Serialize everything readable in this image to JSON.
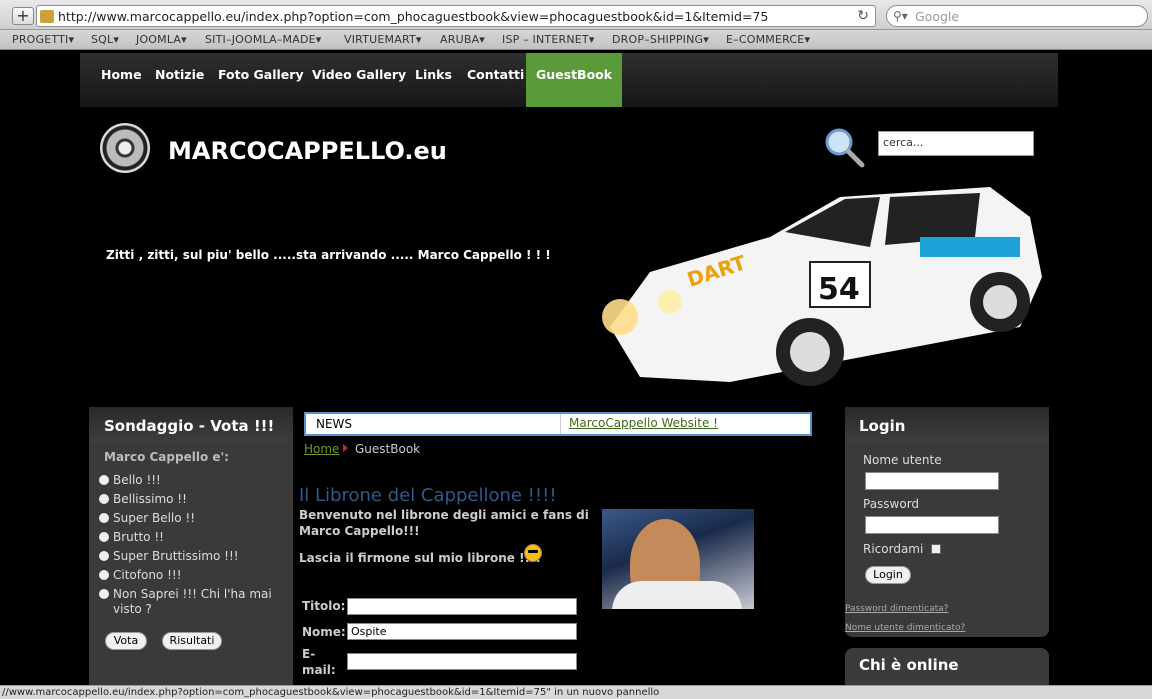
{
  "browser": {
    "url": "http://www.marcocappello.eu/index.php?option=com_phocaguestbook&view=phocaguestbook&id=1&Itemid=75",
    "search_placeholder": "Google",
    "bookmarks": [
      "PROGETTI▾",
      "SQL▾",
      "JOOMLA▾",
      "SITI–JOOMLA–MADE▾",
      "VIRTUEMART▾",
      "ARUBA▾",
      "ISP – INTERNET▾",
      "DROP–SHIPPING▾",
      "E–COMMERCE▾"
    ],
    "status_text": "//www.marcocappello.eu/index.php?option=com_phocaguestbook&view=phocaguestbook&id=1&Itemid=75\" in un nuovo pannello"
  },
  "nav": {
    "items": [
      "Home",
      "Notizie",
      "Foto Gallery",
      "Video Gallery",
      "Links",
      "Contatti",
      "GuestBook"
    ],
    "active": "GuestBook"
  },
  "header": {
    "brand": "MARCOCAPPELLO.eu",
    "tagline": "Zitti , zitti, sul piu' bello .....sta arrivando ..... Marco Cappello ! ! !",
    "search_placeholder": "cerca..."
  },
  "poll": {
    "title": "Sondaggio - Vota !!!",
    "question": "Marco Cappello e':",
    "options": [
      "Bello !!!",
      "Bellissimo !!",
      "Super Bello !!",
      "Brutto !!",
      "Super Bruttissimo !!!",
      "Citofono !!!",
      "Non Saprei !!! Chi l'ha mai",
      "visto ?"
    ],
    "vote_label": "Vota",
    "results_label": "Risultati"
  },
  "news": {
    "label": "NEWS",
    "link": "MarcoCappello Website !"
  },
  "breadcrumb": {
    "home": "Home",
    "current": "GuestBook"
  },
  "guestbook": {
    "title": "Il Librone del Cappellone !!!!",
    "intro_line1": "Benvenuto nel librone degli amici e fans di",
    "intro_line2": "Marco Cappello!!!",
    "sign": "Lascia il firmone sul mio librone !!!!",
    "label_title": "Titolo:",
    "label_name": "Nome:",
    "name_value": "Ospite",
    "label_email_1": "E-",
    "label_email_2": "mail:"
  },
  "login": {
    "title": "Login",
    "username_label": "Nome utente",
    "password_label": "Password",
    "remember_label": "Ricordami",
    "button": "Login",
    "forgot_password": "Password dimenticata?",
    "forgot_username": "Nome utente dimenticato?"
  },
  "online": {
    "title": "Chi è online"
  }
}
